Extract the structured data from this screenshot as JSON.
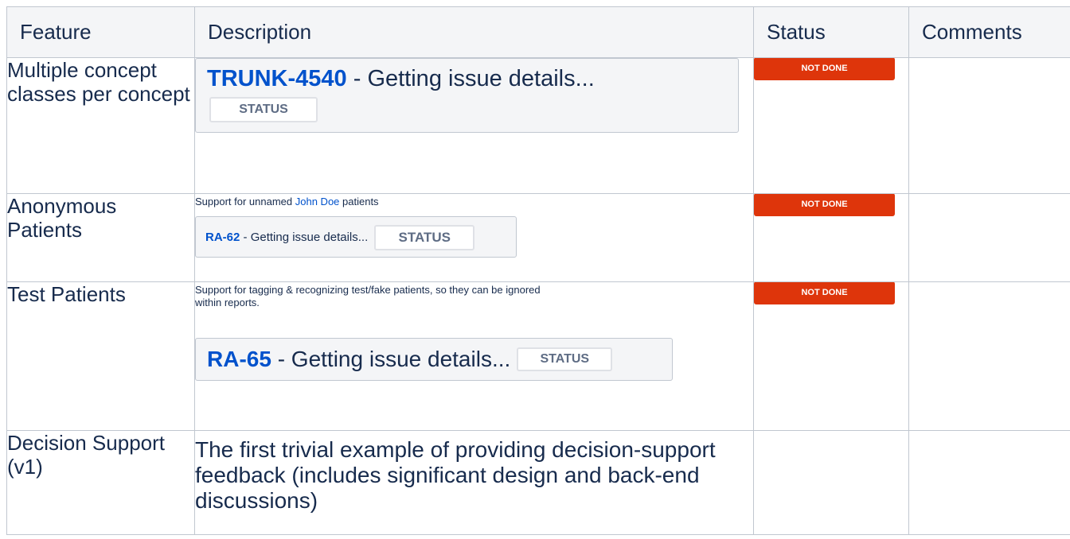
{
  "headers": {
    "feature": "Feature",
    "description": "Description",
    "status": "Status",
    "comments": "Comments"
  },
  "rows": [
    {
      "feature": "Multiple concept classes per concept",
      "issue_key": "TRUNK-4540",
      "issue_text": " - Getting issue details...",
      "issue_status": "STATUS",
      "status": "NOT DONE",
      "comments": ""
    },
    {
      "feature": "Anonymous Patients",
      "desc_before": "Support for unnamed ",
      "desc_link": "John Doe",
      "desc_after": " patients",
      "issue_key": "RA-62",
      "issue_text": " - Getting issue details...",
      "issue_status": "STATUS",
      "status": "NOT DONE",
      "comments": ""
    },
    {
      "feature": "Test Patients",
      "description": "Support for tagging & recognizing test/fake patients, so they can be ignored within reports.",
      "issue_key": "RA-65",
      "issue_text": " - Getting issue details...",
      "issue_status": "STATUS",
      "status": "NOT DONE",
      "comments": ""
    },
    {
      "feature": "Decision Support (v1)",
      "description": "The first trivial example of providing decision-support feedback (includes significant design and back-end discussions)",
      "status": "",
      "comments": ""
    }
  ],
  "colors": {
    "link": "#0052cc",
    "not_done": "#de350b",
    "header_bg": "#f4f5f7",
    "border": "#c1c7d0"
  }
}
